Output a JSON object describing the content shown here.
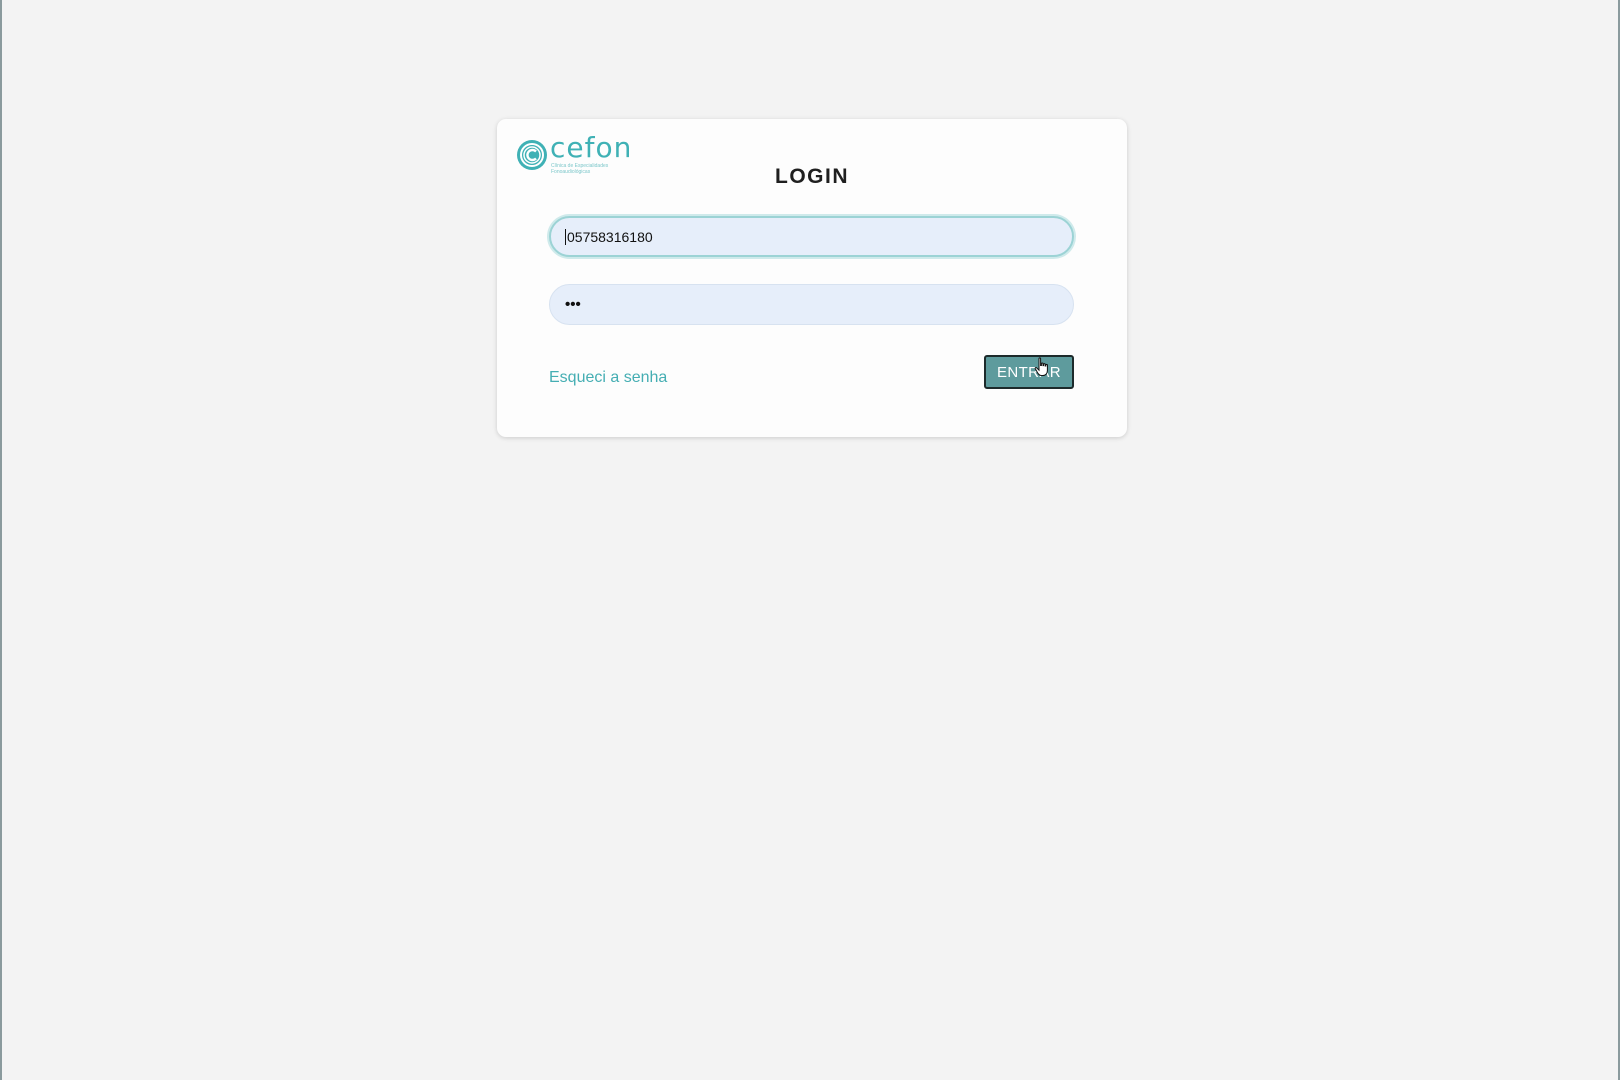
{
  "brand": {
    "name": "cefon",
    "tagline": "Clínica de Especialidades Fonoaudiológicas",
    "accent_color": "#3fb1b5",
    "logo_icon": "cefon-logo-icon"
  },
  "login": {
    "title": "LOGIN",
    "username_value": "05758316180",
    "password_mask": "•••",
    "forgot_password_label": "Esqueci a senha",
    "submit_label": "ENTRAR",
    "submit_color": "#5e9b9d"
  },
  "cursor": {
    "icon": "hand-pointer-icon"
  }
}
